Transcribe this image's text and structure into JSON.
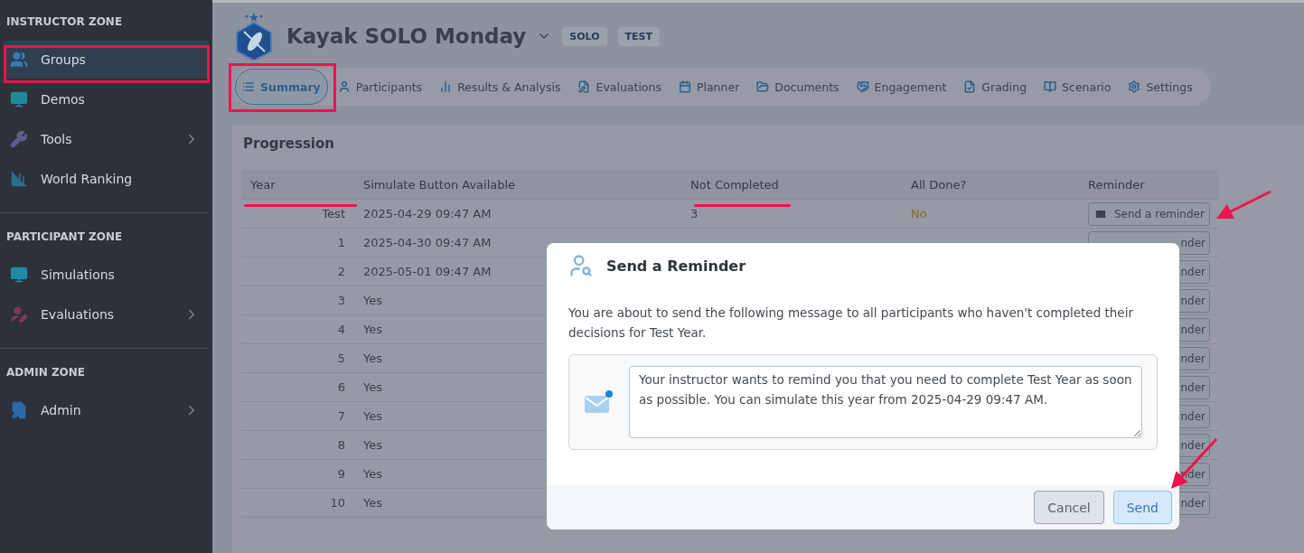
{
  "sidebar": {
    "sections": [
      {
        "title": "INSTRUCTOR ZONE",
        "items": [
          {
            "label": "Groups",
            "selected": true,
            "expandable": false
          },
          {
            "label": "Demos",
            "selected": false,
            "expandable": false
          },
          {
            "label": "Tools",
            "selected": false,
            "expandable": true
          },
          {
            "label": "World Ranking",
            "selected": false,
            "expandable": false
          }
        ]
      },
      {
        "title": "PARTICIPANT ZONE",
        "items": [
          {
            "label": "Simulations",
            "selected": false,
            "expandable": false
          },
          {
            "label": "Evaluations",
            "selected": false,
            "expandable": true
          }
        ]
      },
      {
        "title": "ADMIN ZONE",
        "items": [
          {
            "label": "Admin",
            "selected": false,
            "expandable": true
          }
        ]
      }
    ]
  },
  "header": {
    "title": "Kayak SOLO Monday",
    "badges": [
      "SOLO",
      "TEST"
    ]
  },
  "tabs": [
    {
      "label": "Summary",
      "selected": true
    },
    {
      "label": "Participants",
      "selected": false
    },
    {
      "label": "Results & Analysis",
      "selected": false
    },
    {
      "label": "Evaluations",
      "selected": false
    },
    {
      "label": "Planner",
      "selected": false
    },
    {
      "label": "Documents",
      "selected": false
    },
    {
      "label": "Engagement",
      "selected": false
    },
    {
      "label": "Grading",
      "selected": false
    },
    {
      "label": "Scenario",
      "selected": false
    },
    {
      "label": "Settings",
      "selected": false
    }
  ],
  "panel": {
    "title": "Progression",
    "table": {
      "columns": [
        "Year",
        "Simulate Button Available",
        "Not Completed",
        "All Done?",
        "Reminder"
      ],
      "rows": [
        {
          "year": "Test",
          "simulate": "2025-04-29 09:47 AM",
          "not_completed": "3",
          "all_done": "No",
          "reminder": "Send a reminder",
          "kind": "full"
        },
        {
          "year": "1",
          "simulate": "2025-04-30 09:47 AM",
          "reminder": "nder",
          "kind": "partial"
        },
        {
          "year": "2",
          "simulate": "2025-05-01 09:47 AM",
          "reminder": "nder",
          "kind": "partial"
        },
        {
          "year": "3",
          "simulate": "Yes",
          "reminder": "nder",
          "kind": "partial"
        },
        {
          "year": "4",
          "simulate": "Yes",
          "reminder": "nder",
          "kind": "partial"
        },
        {
          "year": "5",
          "simulate": "Yes",
          "reminder": "nder",
          "kind": "partial"
        },
        {
          "year": "6",
          "simulate": "Yes",
          "reminder": "nder",
          "kind": "partial"
        },
        {
          "year": "7",
          "simulate": "Yes",
          "reminder": "nder",
          "kind": "partial"
        },
        {
          "year": "8",
          "simulate": "Yes",
          "reminder": "nder",
          "kind": "partial"
        },
        {
          "year": "9",
          "simulate": "Yes",
          "reminder": "nder",
          "kind": "partial"
        },
        {
          "year": "10",
          "simulate": "Yes",
          "reminder": "nder",
          "kind": "partial"
        }
      ]
    }
  },
  "modal": {
    "title": "Send a Reminder",
    "text": "You are about to send the following message to all participants who haven't completed their decisions for Test Year.",
    "message": "Your instructor wants to remind you that you need to complete Test Year as soon as possible. You can simulate this year from 2025-04-29 09:47 AM.",
    "buttons": [
      "Cancel",
      "Send"
    ]
  }
}
